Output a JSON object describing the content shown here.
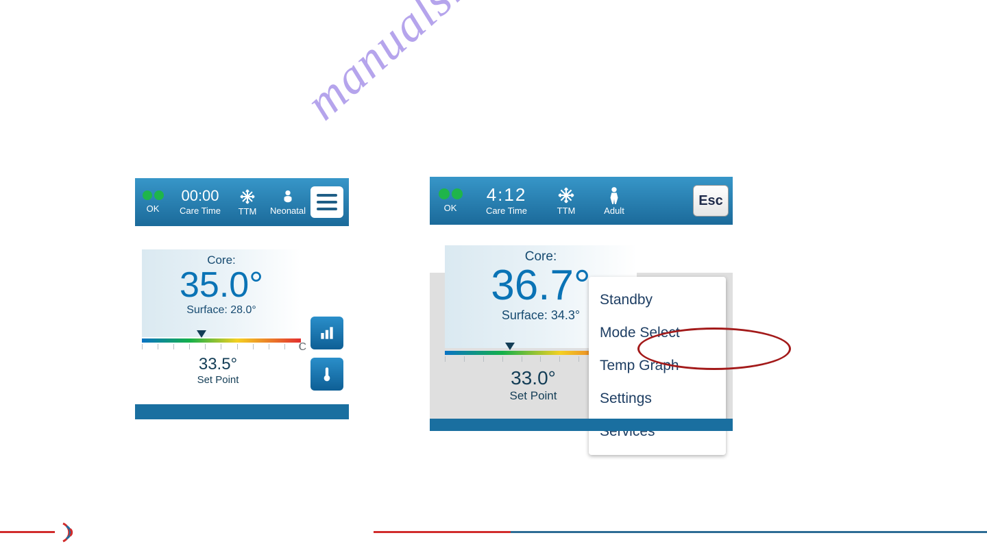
{
  "watermark": "manualshive.com",
  "screen1": {
    "ok": "OK",
    "time": "00:00",
    "time_label": "Care Time",
    "mode": "TTM",
    "patient": "Neonatal",
    "core_label": "Core:",
    "core_value": "35.0°",
    "surface_label": "Surface: 28.0°",
    "unit": "C",
    "setpoint_value": "33.5°",
    "setpoint_label": "Set Point"
  },
  "screen2": {
    "ok": "OK",
    "time": "4:12",
    "time_label": "Care Time",
    "mode": "TTM",
    "patient": "Adult",
    "esc": "Esc",
    "core_label": "Core:",
    "core_value": "36.7°",
    "surface_label": "Surface: 34.3°",
    "setpoint_value": "33.0°",
    "setpoint_label": "Set Point",
    "menu": {
      "i0": "Standby",
      "i1": "Mode Select",
      "i2": "Temp Graph",
      "i3": "Settings",
      "i4": "Services"
    }
  }
}
